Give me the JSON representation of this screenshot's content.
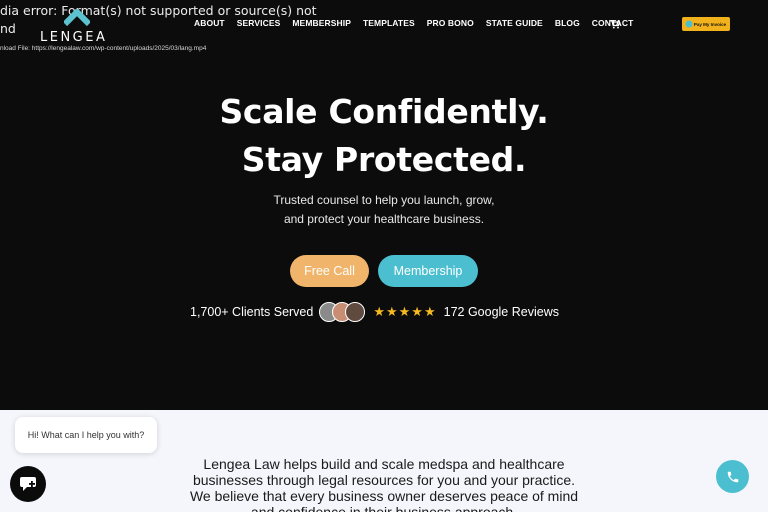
{
  "media_error": {
    "line1": "dia error: Format(s) not supported or source(s) not",
    "line2": "nd",
    "download": "nload File: https://lengealaw.com/wp-content/uploads/2025/03/lang.mp4"
  },
  "logo": {
    "text": "LENGEA",
    "icon": "chevron-up-logo-icon"
  },
  "nav": {
    "items": [
      "ABOUT",
      "SERVICES",
      "MEMBERSHIP",
      "TEMPLATES",
      "PRO BONO",
      "STATE GUIDE",
      "BLOG",
      "CONTACT"
    ],
    "cart_icon": "cart-icon",
    "pay_label": "Pay My Invoice"
  },
  "hero": {
    "headline_1": "Scale Confidently.",
    "headline_2": "Stay Protected.",
    "subtext_1": "Trusted counsel to help you launch, grow,",
    "subtext_2": "and protect your healthcare business.",
    "cta_call": "Free Call",
    "cta_membership": "Membership",
    "clients": "1,700+ Clients Served",
    "stars": "★★★★★",
    "reviews": "172 Google Reviews"
  },
  "about": {
    "line1": "Lengea Law helps build and scale medspa and healthcare",
    "line2": "businesses through legal resources for you and your practice.",
    "line3": "We believe that every business owner deserves peace of mind",
    "line4": "and confidence in their business approach."
  },
  "chat": {
    "greeting": "Hi! What can I help you with?",
    "icon": "chat-icon"
  },
  "phone": {
    "icon": "phone-icon"
  },
  "colors": {
    "background": "#0c0c0c",
    "accent_orange": "#f0b46a",
    "accent_teal": "#4bbfd0",
    "star": "#f5b921",
    "pay_yellow": "#f2b21b"
  }
}
